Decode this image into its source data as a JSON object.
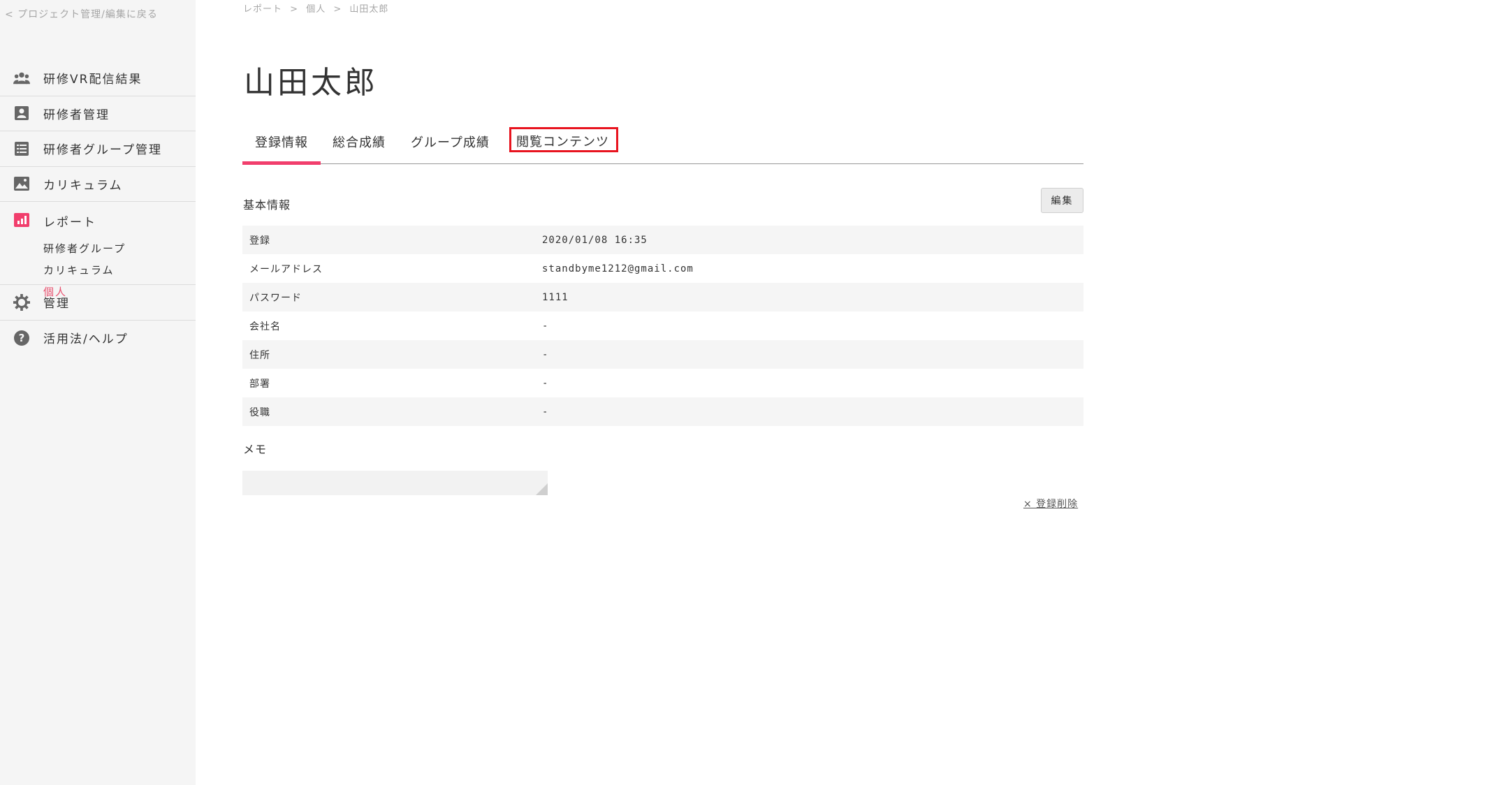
{
  "sidebar": {
    "back_label": "< プロジェクト管理/編集に戻る",
    "items": [
      {
        "label": "研修VR配信結果",
        "icon": "users-icon"
      },
      {
        "label": "研修者管理",
        "icon": "person-card-icon"
      },
      {
        "label": "研修者グループ管理",
        "icon": "list-icon"
      },
      {
        "label": "カリキュラム",
        "icon": "image-icon"
      },
      {
        "label": "レポート",
        "icon": "bar-chart-icon"
      },
      {
        "label": "管理",
        "icon": "gear-icon"
      },
      {
        "label": "活用法/ヘルプ",
        "icon": "help-icon"
      }
    ],
    "report_sub": [
      {
        "label": "研修者グループ"
      },
      {
        "label": "カリキュラム"
      },
      {
        "label": "個人"
      }
    ]
  },
  "breadcrumb": {
    "items": [
      "レポート",
      ">",
      "個人",
      ">",
      "山田太郎"
    ]
  },
  "page_title": "山田太郎",
  "tabs": [
    {
      "label": "登録情報"
    },
    {
      "label": "総合成績"
    },
    {
      "label": "グループ成績"
    },
    {
      "label": "閲覧コンテンツ"
    }
  ],
  "basic_info": {
    "title": "基本情報",
    "edit_label": "編集",
    "rows": [
      {
        "key": "登録",
        "value": "2020/01/08 16:35"
      },
      {
        "key": "メールアドレス",
        "value": "standbyme1212@gmail.com"
      },
      {
        "key": "パスワード",
        "value": "1111"
      },
      {
        "key": "会社名",
        "value": "-"
      },
      {
        "key": "住所",
        "value": "-"
      },
      {
        "key": "部署",
        "value": "-"
      },
      {
        "key": "役職",
        "value": "-"
      }
    ]
  },
  "memo": {
    "label": "メモ",
    "value": ""
  },
  "delete_label": "× 登録削除",
  "colors": {
    "accent": "#f13e6c",
    "highlight_border": "#e8141f",
    "sidebar_bg": "#f5f5f5"
  }
}
